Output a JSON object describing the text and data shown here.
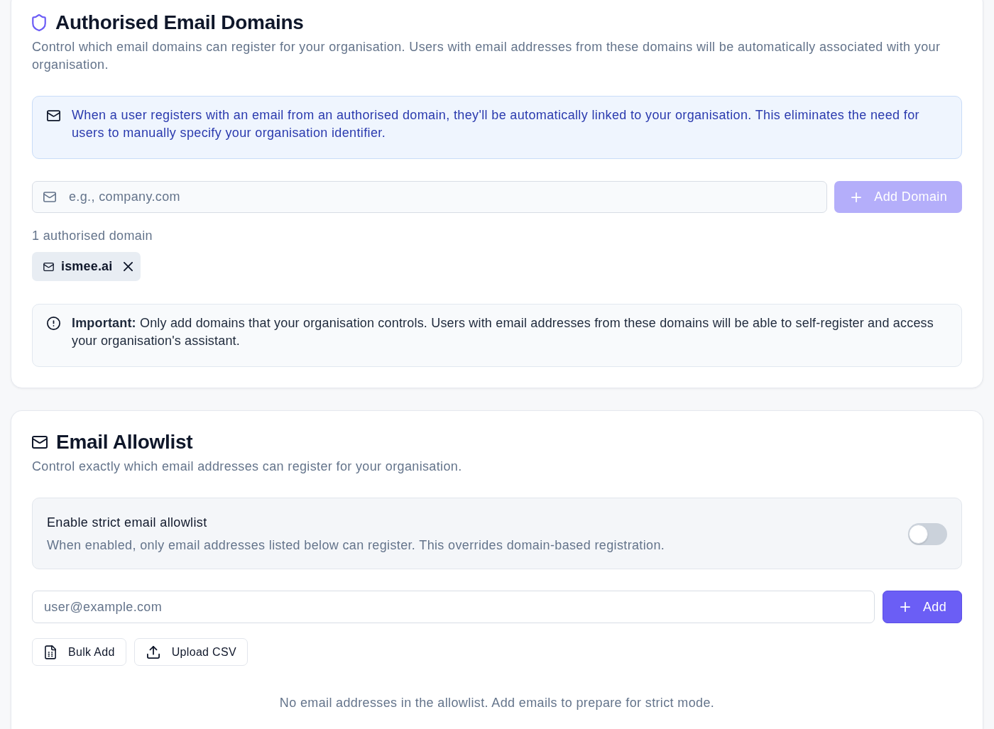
{
  "domains_section": {
    "title": "Authorised Email Domains",
    "description": "Control which email domains can register for your organisation. Users with email addresses from these domains will be automatically associated with your organisation.",
    "info_note": "When a user registers with an email from an authorised domain, they'll be automatically linked to your organisation. This eliminates the need for users to manually specify your organisation identifier.",
    "domain_input": {
      "placeholder": "e.g., company.com"
    },
    "add_button": {
      "label": "Add Domain",
      "disabled": true
    },
    "count_label": "1 authorised domain",
    "domains": [
      "ismee.ai"
    ],
    "warning_note": "**Important:** Only add domains that your organisation controls. Users with email addresses from these domains will be able to self-register and access your organisation's assistant."
  },
  "allowlist_section": {
    "title": "Email Allowlist",
    "description": "Control exactly which email addresses can register for your organisation.",
    "strict_mode": {
      "label": "Enable strict email allowlist",
      "description": "When enabled, only email addresses listed below can register. This overrides domain-based registration.",
      "on": false
    },
    "email_input": {
      "placeholder": "user@example.com"
    },
    "add_button": {
      "label": "Add",
      "disabled": false
    },
    "actions": [
      {
        "kind": "bulk",
        "label": "Bulk Add"
      },
      {
        "kind": "upload",
        "label": "Upload CSV"
      }
    ],
    "empty_message": "No email addresses in the allowlist. Add emails to prepare for strict mode."
  }
}
